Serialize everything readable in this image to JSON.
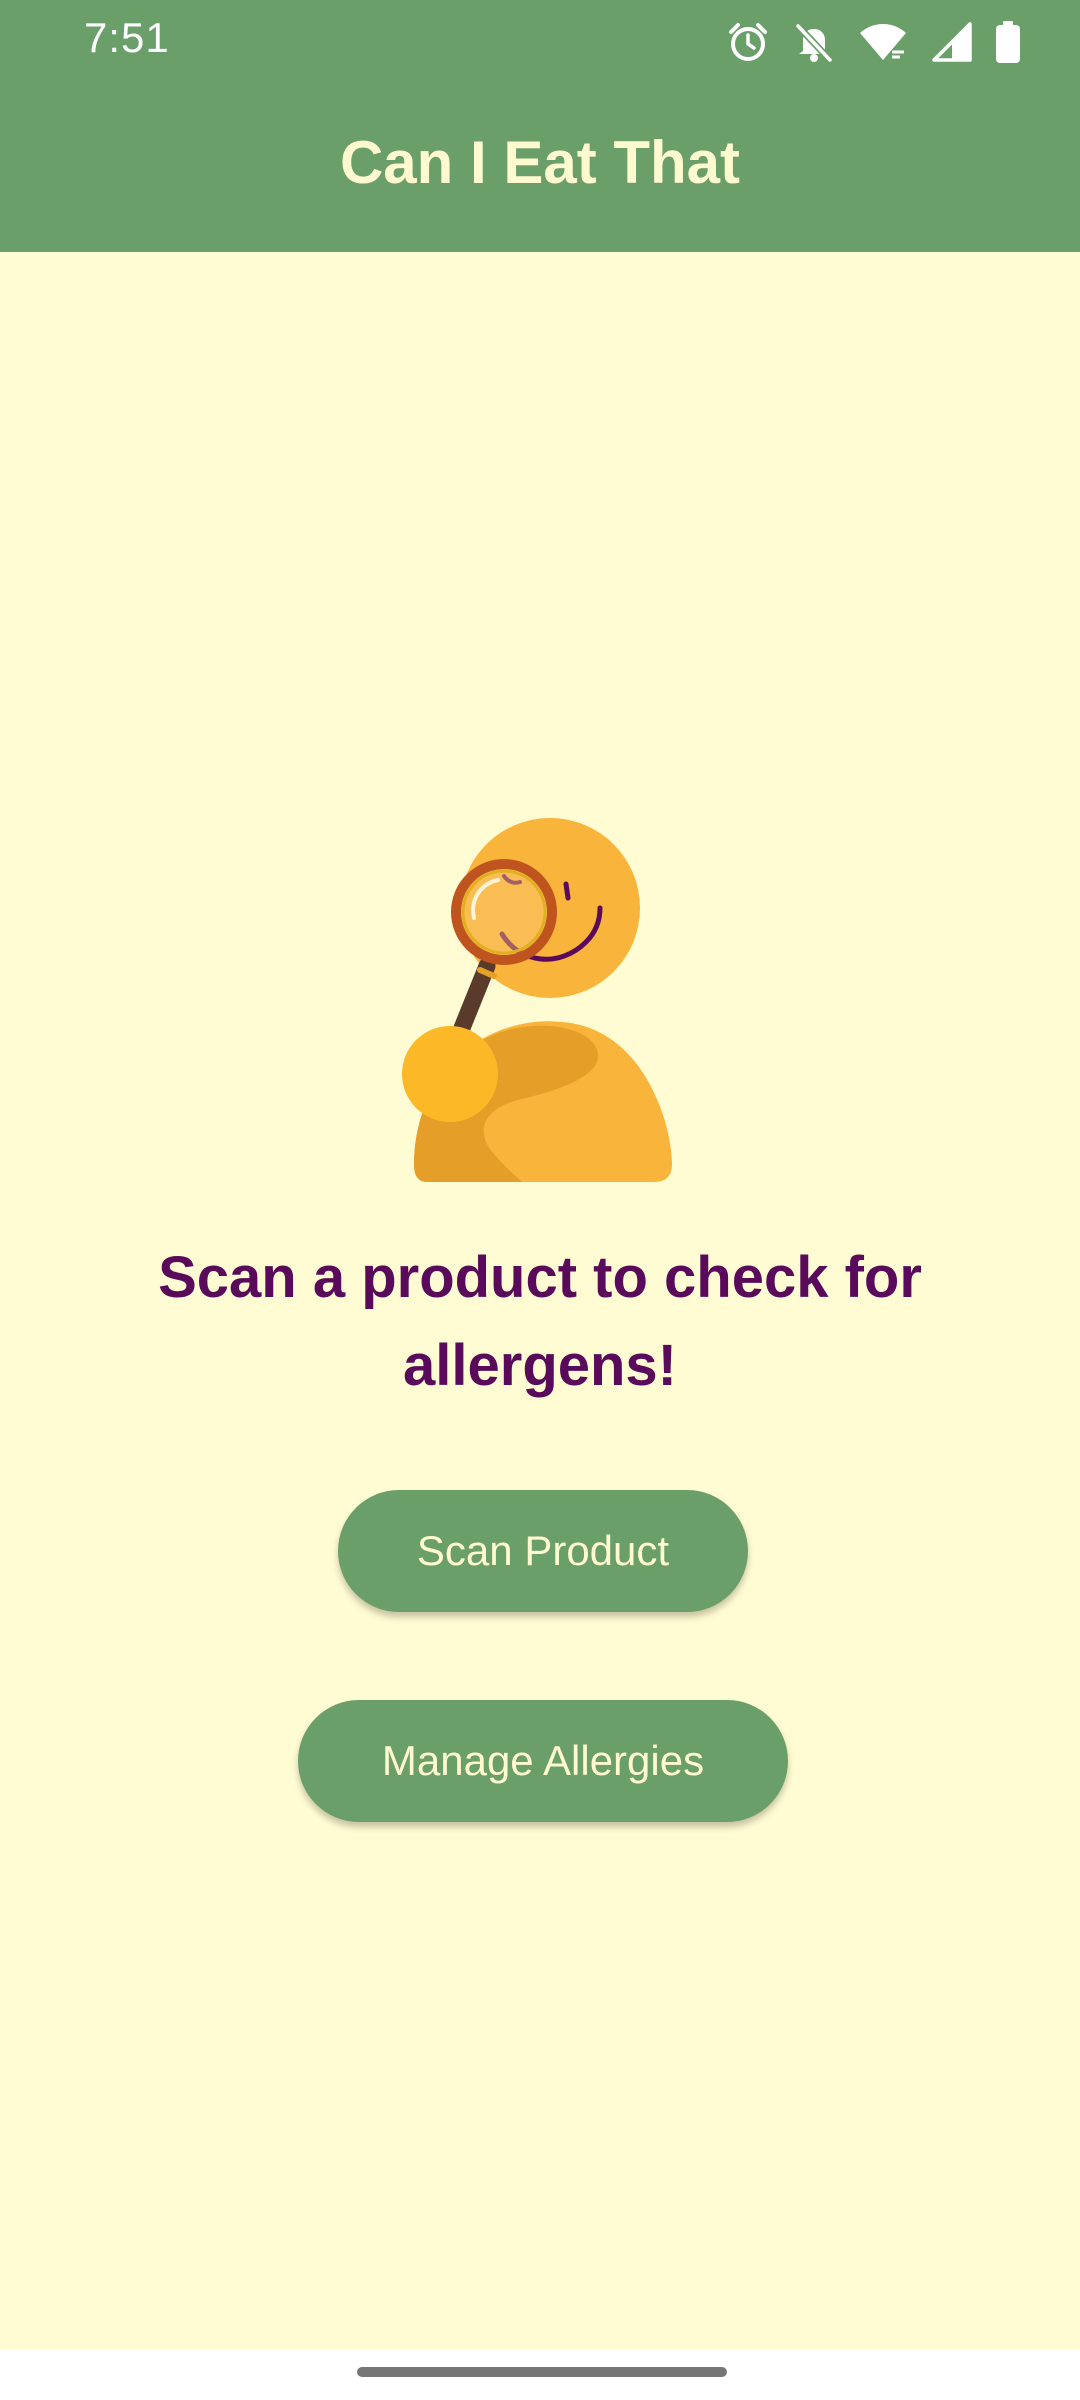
{
  "status_bar": {
    "time": "7:51",
    "icons": [
      "alarm-icon",
      "notifications-off-icon",
      "wifi-icon",
      "signal-icon",
      "battery-icon"
    ]
  },
  "app_bar": {
    "title": "Can I Eat That"
  },
  "main": {
    "illustration": "person-with-magnifying-glass",
    "headline": "Scan a product to check for allergens!",
    "scan_button_label": "Scan Product",
    "manage_button_label": "Manage Allergies"
  },
  "colors": {
    "app_bar": "#6A9F6A",
    "background": "#FFFBD2",
    "title_text": "#FFF9CF",
    "headline_text": "#5A0A5A",
    "button": "#6A9F6A",
    "illustration_primary": "#F9B43C",
    "illustration_shadow": "#E59E28",
    "magnifier_ring": "#C0541E"
  }
}
